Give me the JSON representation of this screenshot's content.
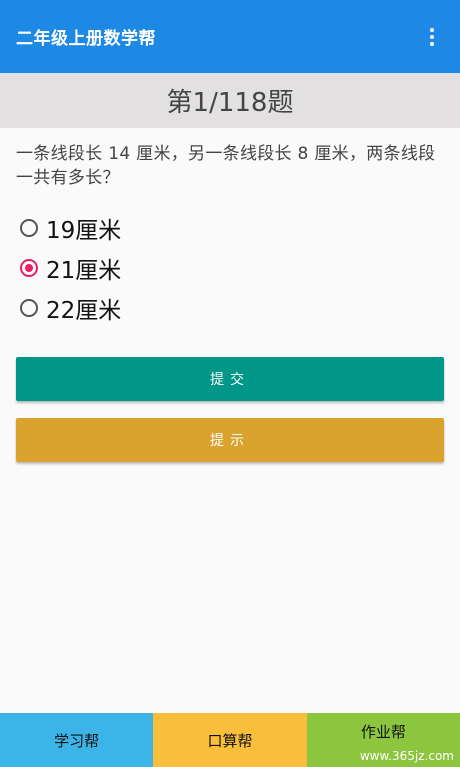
{
  "appbar": {
    "title": "二年级上册数学帮",
    "more_icon": "more-vert-icon",
    "color": "#1e88e5"
  },
  "counter": {
    "text": "第1/118题"
  },
  "question": {
    "text": "一条线段长 14 厘米，另一条线段长 8 厘米，两条线段一共有多长？"
  },
  "options": [
    {
      "label": "19厘米",
      "selected": false
    },
    {
      "label": "21厘米",
      "selected": true
    },
    {
      "label": "22厘米",
      "selected": false
    }
  ],
  "buttons": {
    "submit_label": "提交",
    "hint_label": "提示",
    "submit_color": "#009688",
    "hint_color": "#d9a32e"
  },
  "bottom_nav": {
    "study": "学习帮",
    "calc": "口算帮",
    "homework": "作业帮"
  },
  "watermark": "www.365jz.com"
}
